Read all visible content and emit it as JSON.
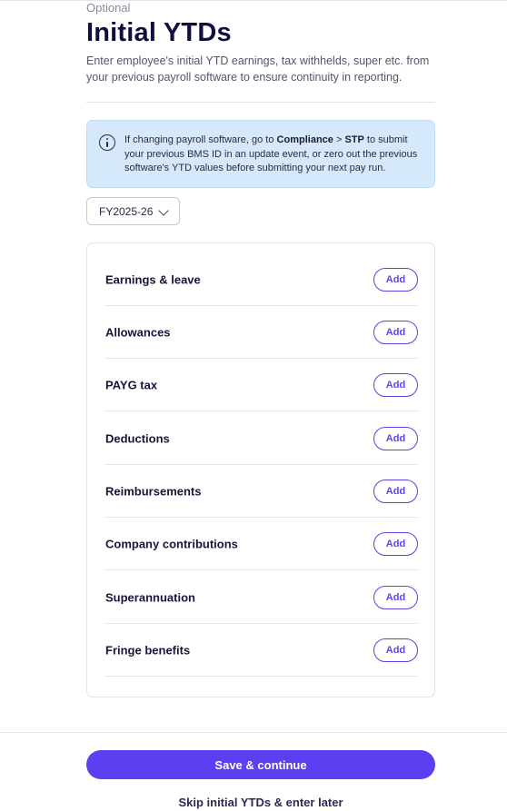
{
  "header": {
    "eyebrow": "Optional",
    "title": "Initial YTDs",
    "description": "Enter employee's initial YTD earnings, tax withhelds, super etc. from your previous payroll software to ensure continuity in reporting."
  },
  "info_banner": {
    "icon": "info-icon",
    "text_before": "If changing payroll software, go to ",
    "link_compliance": "Compliance",
    "separator": " > ",
    "link_stp": "STP",
    "text_after": " to submit your previous BMS ID in an update event, or zero out the previous software's YTD values before submitting your next pay run."
  },
  "fy_select": {
    "value": "FY2025-26",
    "icon": "chevron-down-icon"
  },
  "categories": [
    {
      "label": "Earnings & leave",
      "action": "Add"
    },
    {
      "label": "Allowances",
      "action": "Add"
    },
    {
      "label": "PAYG tax",
      "action": "Add"
    },
    {
      "label": "Deductions",
      "action": "Add"
    },
    {
      "label": "Reimbursements",
      "action": "Add"
    },
    {
      "label": "Company contributions",
      "action": "Add"
    },
    {
      "label": "Superannuation",
      "action": "Add"
    },
    {
      "label": "Fringe benefits",
      "action": "Add"
    }
  ],
  "footer": {
    "primary_label": "Save & continue",
    "secondary_label": "Skip initial YTDs & enter later"
  },
  "colors": {
    "accent": "#5b3ff0",
    "banner_bg": "#d6e8fb",
    "title": "#0f0f3d"
  }
}
